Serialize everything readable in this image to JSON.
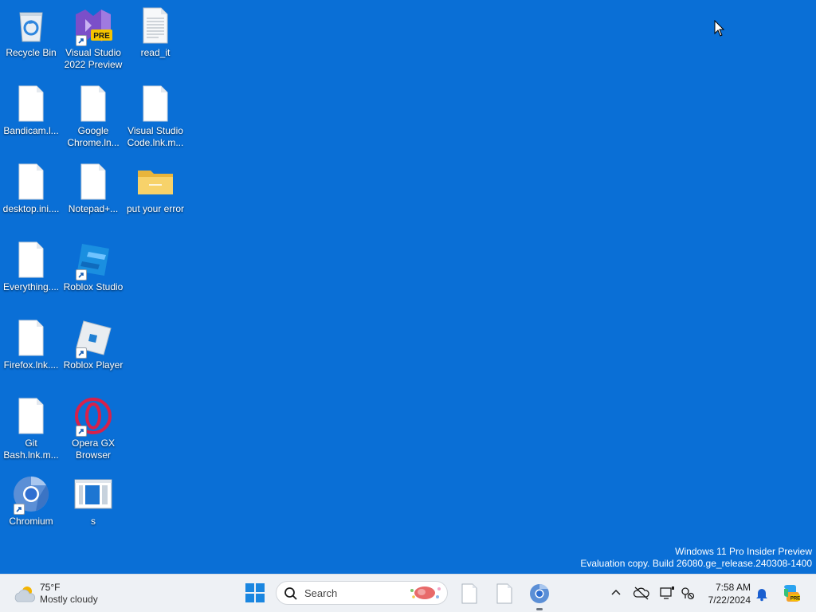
{
  "desktop": {
    "background_color": "#0a6fd6",
    "icons": [
      {
        "label": "Recycle Bin",
        "icon": "recycle-bin-icon"
      },
      {
        "label": "Visual Studio 2022 Preview",
        "icon": "visual-studio-preview-icon",
        "badge": "PRE"
      },
      {
        "label": "read_it",
        "icon": "text-document-icon"
      },
      {
        "label": "Bandicam.l...",
        "icon": "blank-file-icon"
      },
      {
        "label": "Google Chrome.ln...",
        "icon": "blank-file-icon"
      },
      {
        "label": "Visual Studio Code.lnk.m...",
        "icon": "blank-file-icon"
      },
      {
        "label": "desktop.ini....",
        "icon": "blank-file-icon"
      },
      {
        "label": "Notepad+...",
        "icon": "blank-file-icon"
      },
      {
        "label": "put your error",
        "icon": "folder-icon"
      },
      {
        "label": "Everything....",
        "icon": "blank-file-icon"
      },
      {
        "label": "Roblox Studio",
        "icon": "roblox-studio-icon"
      },
      {
        "label": "Firefox.lnk....",
        "icon": "blank-file-icon"
      },
      {
        "label": "Roblox Player",
        "icon": "roblox-player-icon"
      },
      {
        "label": "Git Bash.lnk.m...",
        "icon": "blank-file-icon"
      },
      {
        "label": "Opera GX Browser",
        "icon": "opera-gx-icon"
      },
      {
        "label": "Chromium",
        "icon": "chromium-icon"
      },
      {
        "label": "s",
        "icon": "window-app-icon"
      }
    ]
  },
  "watermark": {
    "line1": "Windows 11 Pro Insider Preview",
    "line2": "Evaluation copy. Build 26080.ge_release.240308-1400"
  },
  "taskbar": {
    "weather": {
      "temperature": "75°F",
      "condition": "Mostly cloudy"
    },
    "search": {
      "placeholder": "Search"
    },
    "pinned_apps": [
      "blank-file-icon",
      "blank-file-icon",
      "chromium-icon"
    ],
    "clock": {
      "time": "7:58 AM",
      "date": "7/22/2024"
    },
    "tray_icons": [
      "chevron-up-icon",
      "cloud-off-icon",
      "display-icon",
      "network-icon",
      "bell-icon",
      "copilot-icon"
    ]
  }
}
